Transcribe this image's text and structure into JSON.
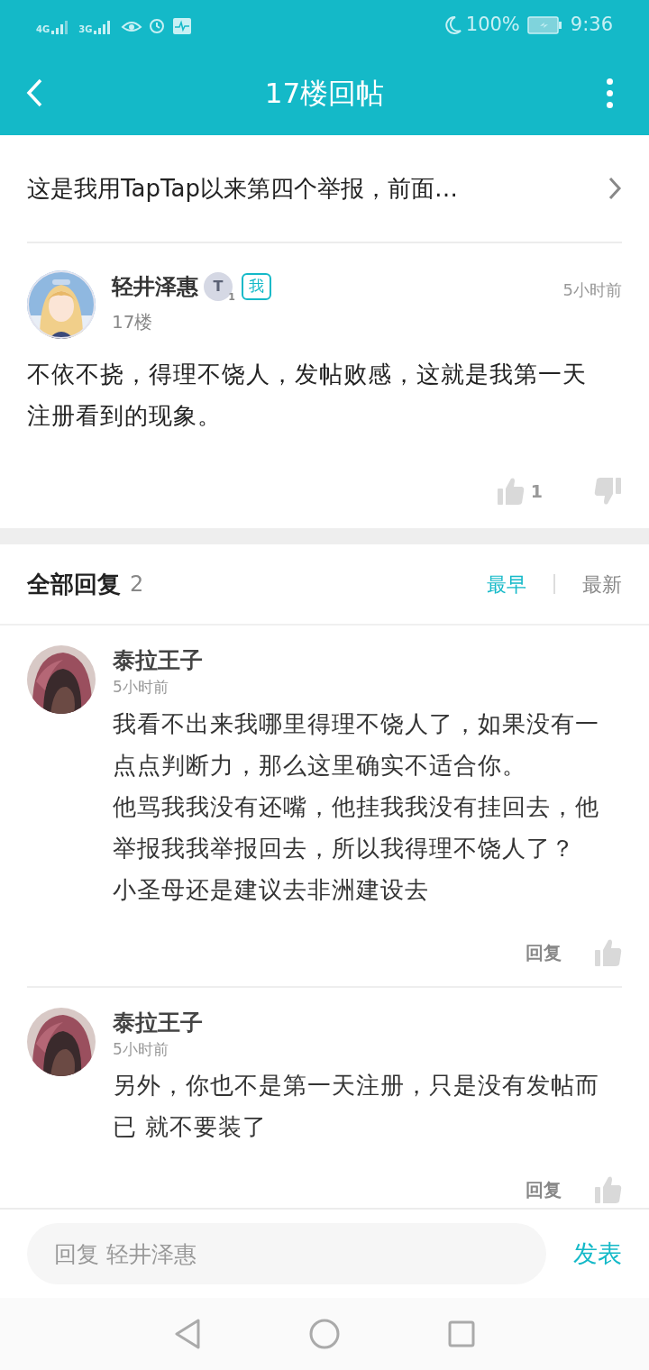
{
  "status_bar": {
    "network_1": "4G",
    "network_2": "3G",
    "battery": "100%",
    "time": "9:36"
  },
  "header": {
    "title": "17楼回帖"
  },
  "topic": {
    "text": "这是我用TapTap以来第四个举报，前面…"
  },
  "post": {
    "author": "轻井泽惠",
    "badge_letter": "T",
    "badge_sub": "1",
    "me_tag": "我",
    "floor": "17楼",
    "time": "5小时前",
    "body": "不依不挠，得理不饶人，发帖败感，这就是我第一天注册看到的现象。",
    "likes": "1"
  },
  "replies_header": {
    "title": "全部回复",
    "count": "2",
    "sort": [
      {
        "label": "最早",
        "selected": true
      },
      {
        "label": "最新",
        "selected": false
      }
    ]
  },
  "replies": [
    {
      "author": "泰拉王子",
      "time": "5小时前",
      "paragraphs": [
        "我看不出来我哪里得理不饶人了，如果没有一点点判断力，那么这里确实不适合你。",
        "他骂我我没有还嘴，他挂我我没有挂回去，他举报我我举报回去，所以我得理不饶人了？",
        "小圣母还是建议去非洲建设去"
      ],
      "reply_label": "回复"
    },
    {
      "author": "泰拉王子",
      "time": "5小时前",
      "paragraphs": [
        "另外，你也不是第一天注册，只是没有发帖而已 就不要装了"
      ],
      "reply_label": "回复"
    }
  ],
  "composer": {
    "placeholder": "回复 轻井泽惠",
    "send": "发表"
  }
}
